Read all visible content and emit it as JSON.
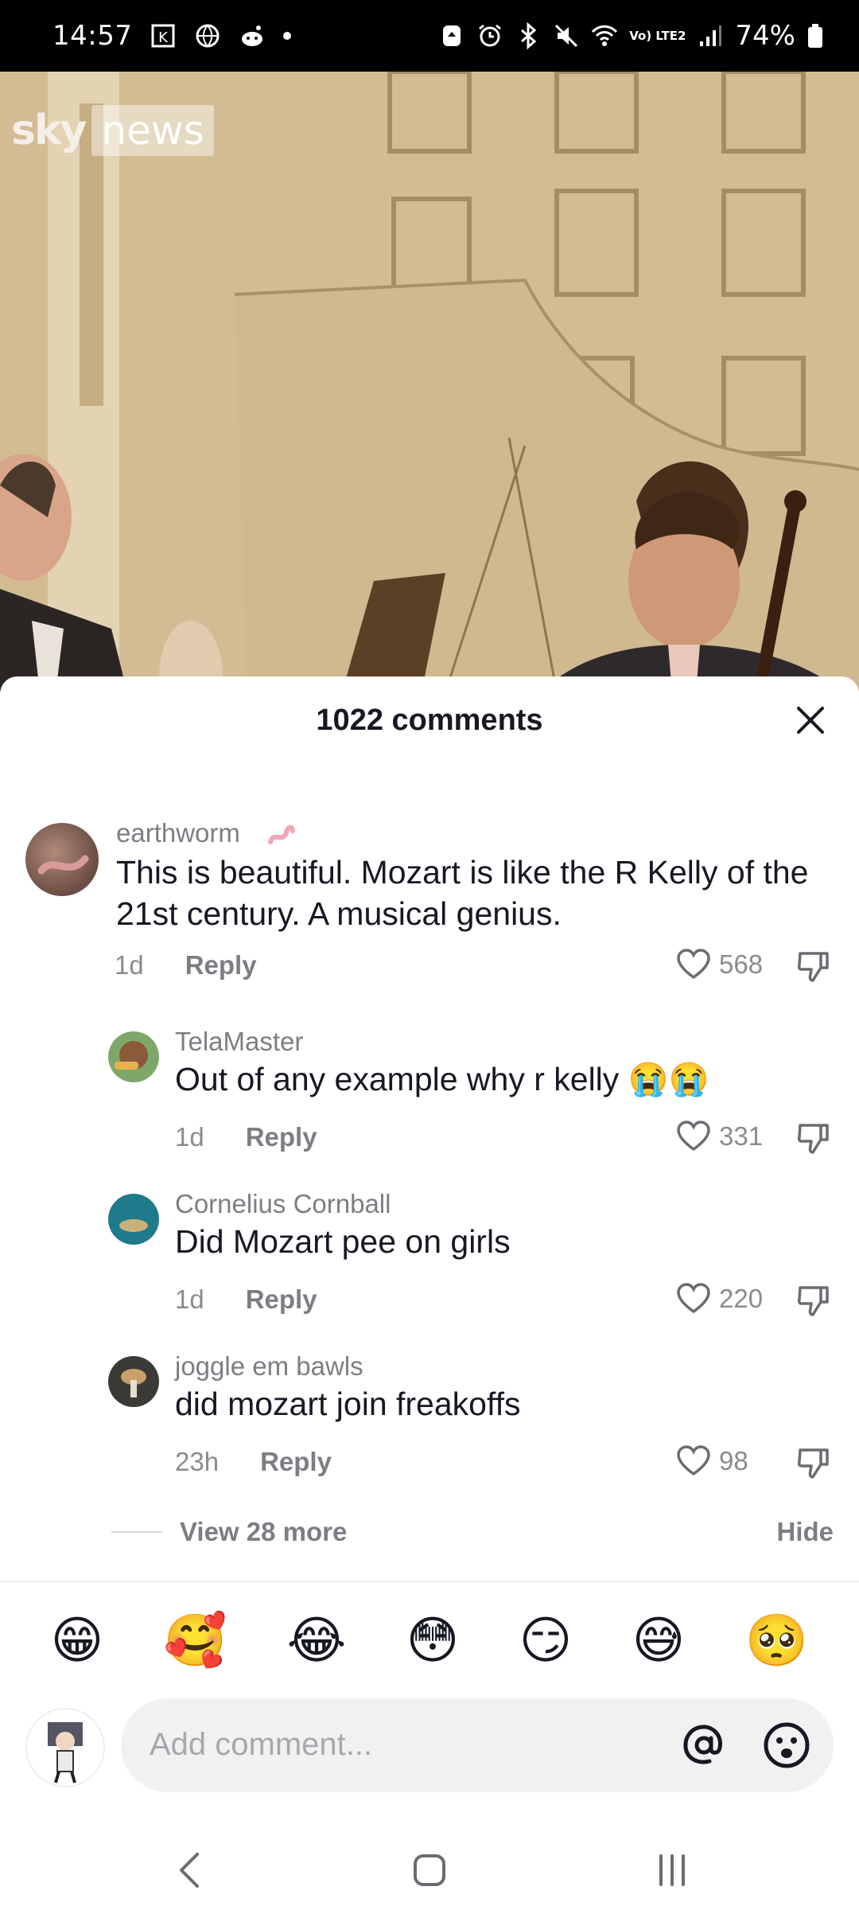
{
  "status_bar": {
    "time": "14:57",
    "network_label": "Vo) LTE2",
    "battery": "74%"
  },
  "video": {
    "logo_sky": "sky",
    "logo_news": "news"
  },
  "comments_header": {
    "title": "1022 comments"
  },
  "comments": [
    {
      "username": "earthworm",
      "username_emoji": "worm",
      "text": "This is beautiful. Mozart is like the R Kelly of the 21st century. A musical genius.",
      "age": "1d",
      "reply_label": "Reply",
      "likes": "568"
    },
    {
      "username": "TelaMaster",
      "text": "Out of any example why r kelly 😭😭",
      "age": "1d",
      "reply_label": "Reply",
      "likes": "331"
    },
    {
      "username": "Cornelius Cornball",
      "text": "Did Mozart pee on girls",
      "age": "1d",
      "reply_label": "Reply",
      "likes": "220"
    },
    {
      "username": "joggle em bawls",
      "text": "did mozart join freakoffs",
      "age": "23h",
      "reply_label": "Reply",
      "likes": "98"
    }
  ],
  "thread": {
    "view_more": "View 28 more",
    "hide": "Hide"
  },
  "quick_emojis": [
    "😁",
    "🥰",
    "😂",
    "😳",
    "😏",
    "😅",
    "🥺"
  ],
  "composer": {
    "placeholder": "Add comment..."
  },
  "colors": {
    "text_primary": "#161823",
    "text_secondary": "#8a8b91",
    "input_bg": "#f1f1f2"
  }
}
